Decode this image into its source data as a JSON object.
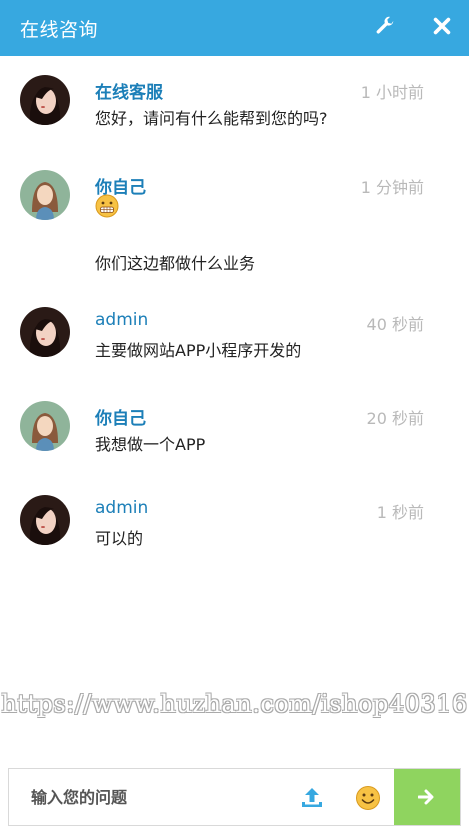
{
  "header": {
    "title": "在线咨询",
    "tool_icon": "wrench-icon",
    "close_icon": "close-icon"
  },
  "messages": [
    {
      "name": "在线客服",
      "time": "1 小时前",
      "text": "您好，请问有什么能帮到您的吗?",
      "avatar": "agent"
    },
    {
      "name": "你自己",
      "time": "1 分钟前",
      "text": "你们这边都做什么业务",
      "avatar": "user",
      "emoji": "grimacing-emoji"
    },
    {
      "name": "admin",
      "time": "40 秒前",
      "text": "主要做网站APP小程序开发的",
      "avatar": "agent"
    },
    {
      "name": "你自己",
      "time": "20 秒前",
      "text": "我想做一个APP",
      "avatar": "user"
    },
    {
      "name": "admin",
      "time": "1 秒前",
      "text": "可以的",
      "avatar": "agent"
    }
  ],
  "watermark": "https://www.huzhan.com/ishop40316",
  "input": {
    "placeholder": "输入您的问题",
    "value": ""
  },
  "colors": {
    "header": "#37a8e0",
    "send": "#8fd45f",
    "name": "#1c7fb8"
  }
}
